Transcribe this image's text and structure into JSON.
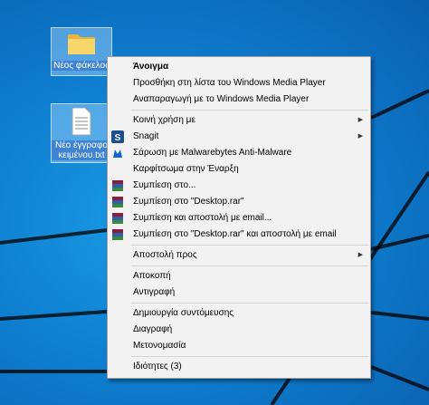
{
  "desktop": {
    "icons": [
      {
        "label": "Νέος φάκελος"
      },
      {
        "label_line1": "Νέο έγγραφο",
        "label_line2": "κειμένου.txt"
      }
    ]
  },
  "menu": {
    "open": "Άνοιγμα",
    "add_wmp": "Προσθήκη στη λίστα του Windows Media Player",
    "play_wmp": "Αναπαραγωγή με το Windows Media Player",
    "share_with": "Κοινή χρήση με",
    "snagit": "Snagit",
    "malwarebytes": "Σάρωση με Malwarebytes Anti-Malware",
    "pin_start": "Καρφίτσωμα στην Έναρξη",
    "compress": "Συμπίεση στο...",
    "compress_rar": "Συμπίεση στο \"Desktop.rar\"",
    "compress_email": "Συμπίεση και αποστολή με email...",
    "compress_rar_email": "Συμπίεση στο \"Desktop.rar\" και αποστολή με email",
    "send_to": "Αποστολή προς",
    "cut": "Αποκοπή",
    "copy": "Αντιγραφή",
    "create_shortcut": "Δημιουργία συντόμευσης",
    "delete": "Διαγραφή",
    "rename": "Μετονομασία",
    "properties": "Ιδιότητες (3)",
    "submenu_arrow": "▶"
  },
  "colors": {
    "desktop_bg": "#0f7fd0",
    "menu_bg": "#f2f2f2",
    "folder": "#f2c94c",
    "winrar": "#8b1e3f",
    "snagit": "#1d4f91",
    "malwarebytes": "#1266c7"
  }
}
